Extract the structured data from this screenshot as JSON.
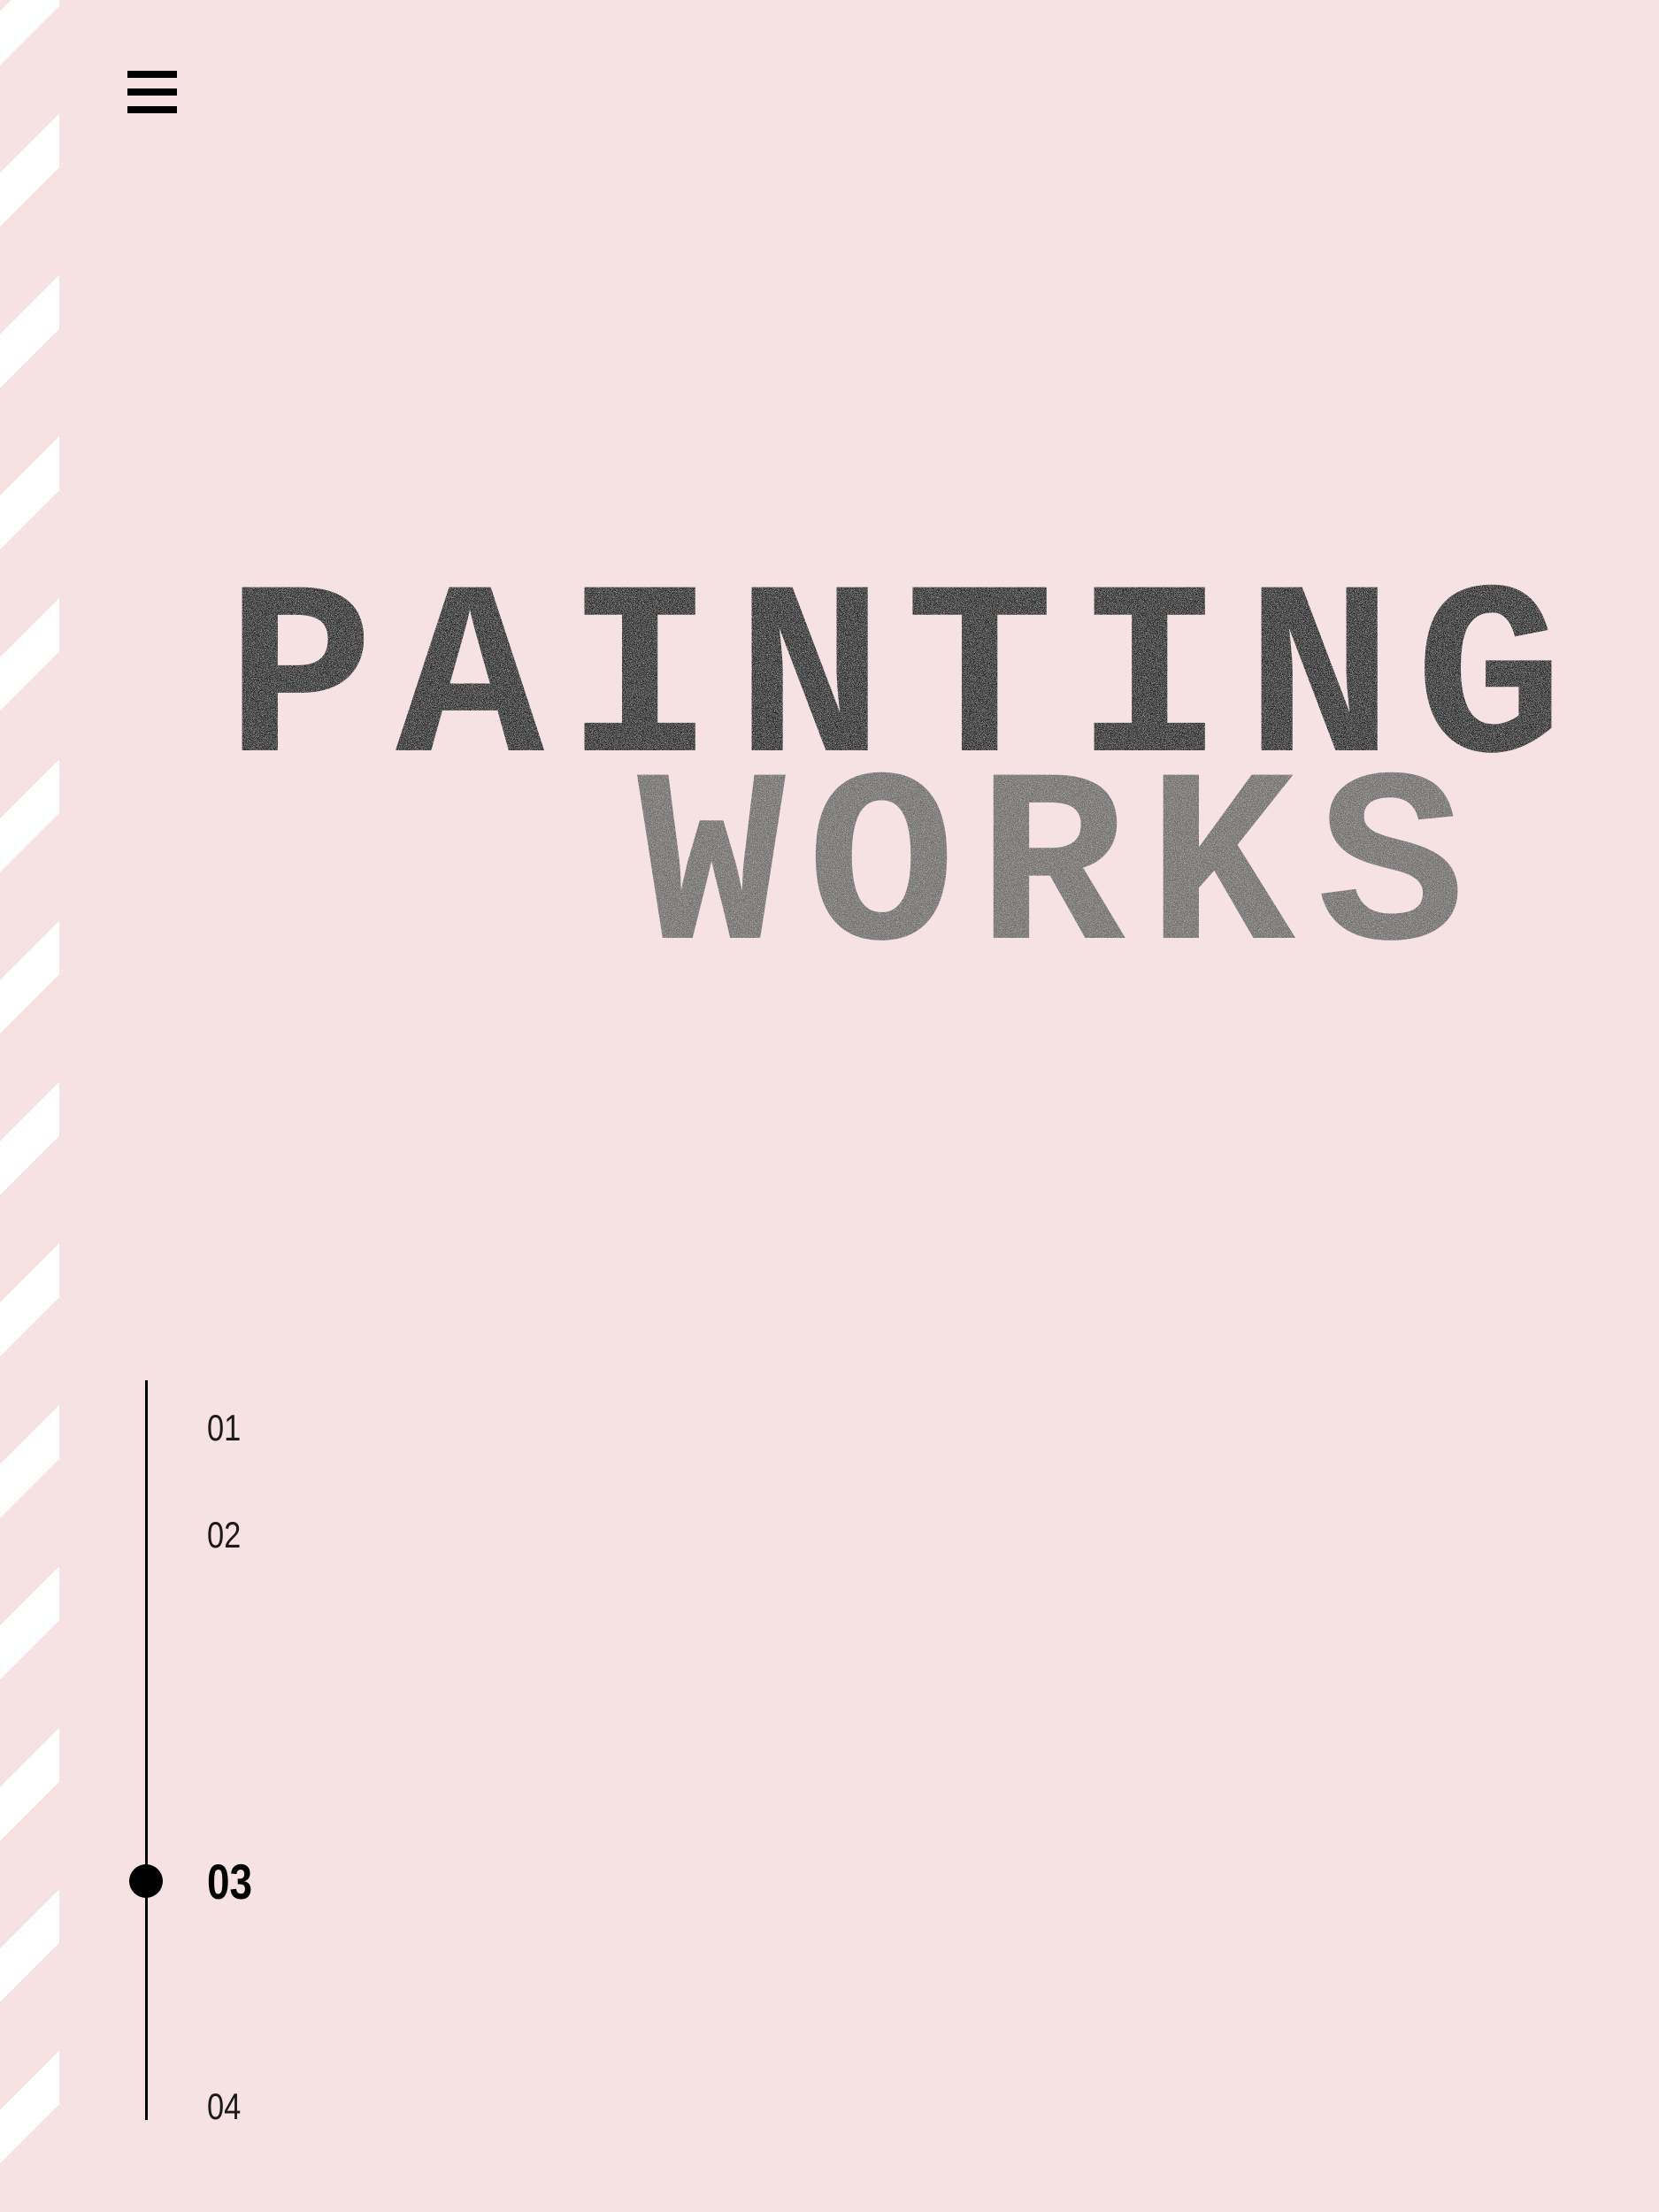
{
  "background_color": "#f6e2e3",
  "hero": {
    "line1": "PAINTING",
    "line2": "WORKS",
    "line1_color": "#232323",
    "line2_color": "#6e6a6b"
  },
  "menu": {
    "icon": "hamburger-menu-icon"
  },
  "timeline": {
    "active_index": 3,
    "steps": [
      {
        "label": "01"
      },
      {
        "label": "02"
      },
      {
        "label": "03"
      },
      {
        "label": "04"
      }
    ]
  }
}
